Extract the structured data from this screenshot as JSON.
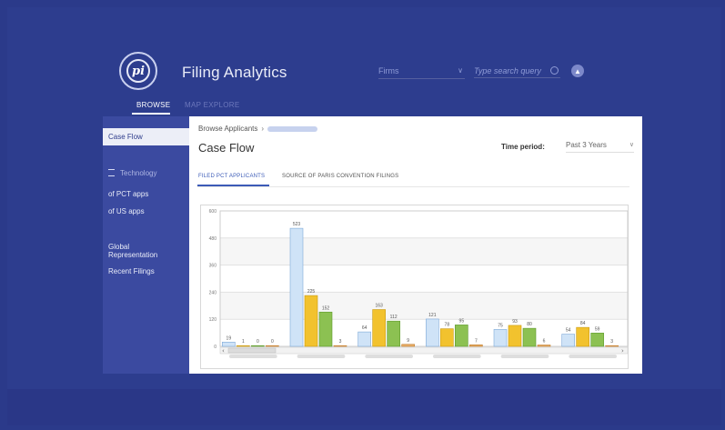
{
  "header": {
    "app_title": "Filing Analytics",
    "logo_text": "pi",
    "firms_select": "Firms",
    "search_placeholder": "Type search query",
    "nav_tabs": [
      "BROWSE",
      "MAP EXPLORE"
    ]
  },
  "sidebar": {
    "items": [
      "Case Flow",
      "Technology",
      "of PCT apps",
      "of US apps",
      "Global",
      "Representation",
      "Recent Filings"
    ]
  },
  "main": {
    "breadcrumb": "Browse Applicants",
    "title": "Case Flow",
    "time_period_label": "Time period:",
    "time_period_value": "Past 3 Years",
    "tabs": [
      "FILED PCT APPLICANTS",
      "SOURCE OF PARIS CONVENTION FILINGS"
    ]
  },
  "colors": {
    "background": "#2d3d8e",
    "sidebar": "#3b4aa0",
    "accent": "#3c5bb7",
    "bar_blue": "#cfe3f7",
    "bar_yellow": "#f2c22e",
    "bar_green": "#8cc152",
    "bar_orange": "#e8b06a"
  },
  "chart_data": {
    "type": "bar",
    "ylim": [
      0,
      600
    ],
    "yticks": [
      0,
      120,
      240,
      360,
      480,
      600
    ],
    "categories": [
      "",
      "",
      "",
      "",
      "",
      ""
    ],
    "series": [
      {
        "values": [
          19,
          523,
          64,
          121,
          75,
          54
        ]
      },
      {
        "values": [
          1,
          225,
          163,
          78,
          93,
          84
        ]
      },
      {
        "values": [
          0,
          152,
          112,
          95,
          80,
          59
        ]
      },
      {
        "values": [
          0,
          3,
          9,
          7,
          6,
          3
        ]
      }
    ]
  }
}
